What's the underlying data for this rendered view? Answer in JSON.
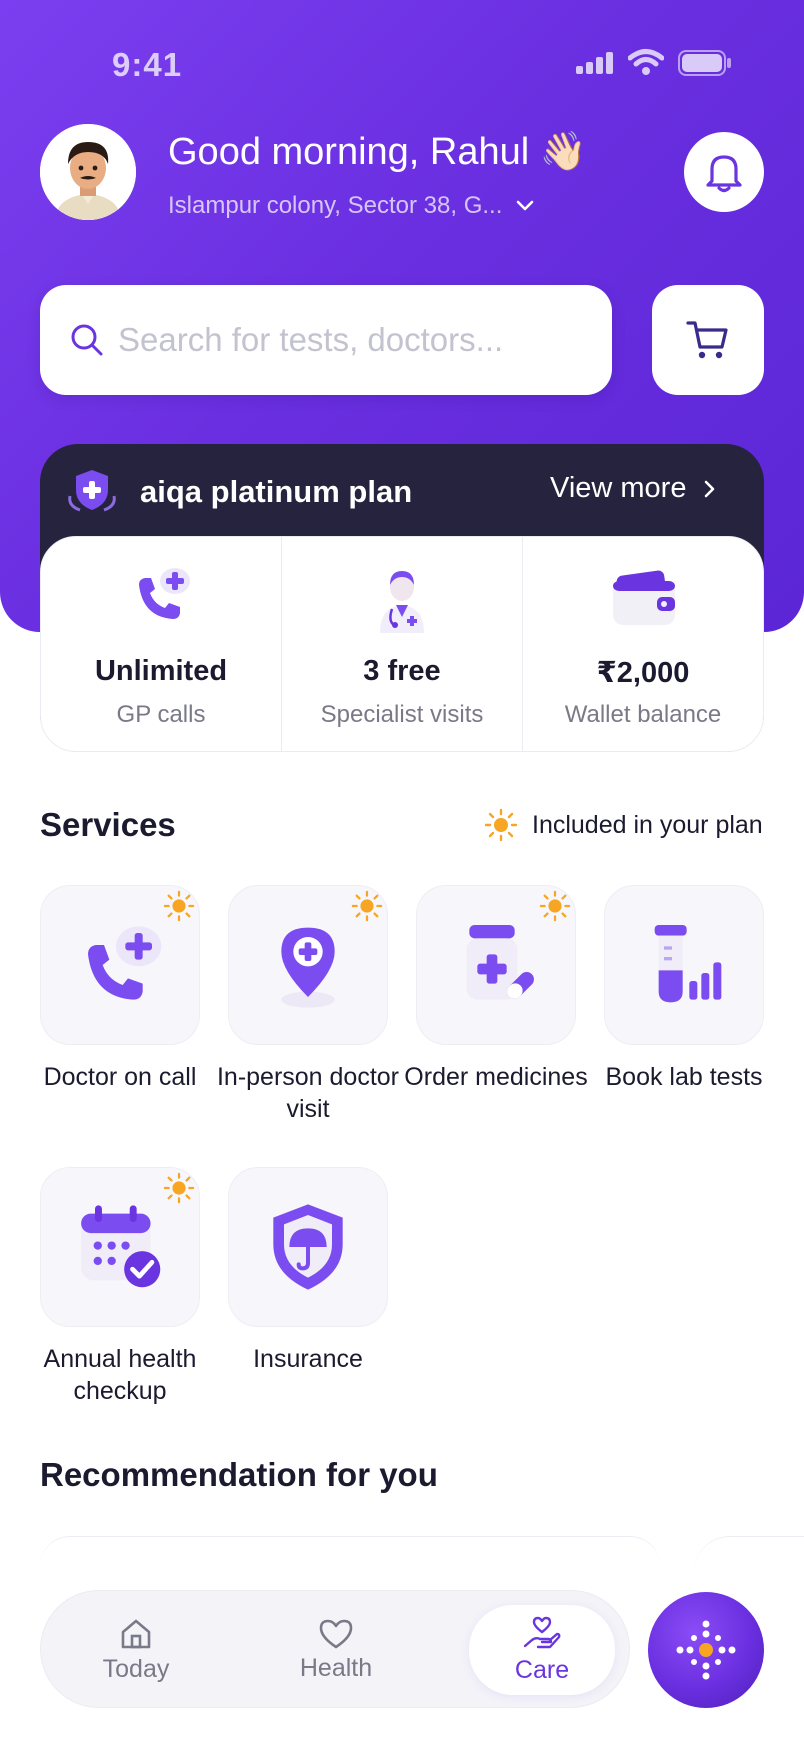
{
  "status_bar": {
    "time": "9:41"
  },
  "header": {
    "greeting": "Good morning, Rahul",
    "wave_emoji": "👋🏻",
    "location": "Islampur colony, Sector 38, G...",
    "avatar_icon": "man-avatar-icon",
    "bell_icon": "bell-icon"
  },
  "search": {
    "placeholder": "Search for tests, doctors...",
    "cart_icon": "cart-icon"
  },
  "plan": {
    "title": "aiqa platinum plan",
    "view_more": "View more",
    "cards": [
      {
        "value": "Unlimited",
        "label": "GP calls",
        "icon": "phone-plus-icon"
      },
      {
        "value": "3 free",
        "label": "Specialist visits",
        "icon": "doctor-icon"
      },
      {
        "value": "₹2,000",
        "label": "Wallet balance",
        "icon": "wallet-icon"
      }
    ]
  },
  "services": {
    "title": "Services",
    "legend": "Included in your plan",
    "items": [
      {
        "label": "Doctor on call",
        "included": true,
        "icon": "phone-plus-icon"
      },
      {
        "label": "In-person doctor visit",
        "included": true,
        "icon": "location-pin-icon"
      },
      {
        "label": "Order medicines",
        "included": true,
        "icon": "medicine-bottle-icon"
      },
      {
        "label": "Book lab tests",
        "included": false,
        "icon": "test-tube-icon"
      },
      {
        "label": "Annual health checkup",
        "included": true,
        "icon": "calendar-check-icon"
      },
      {
        "label": "Insurance",
        "included": false,
        "icon": "shield-umbrella-icon"
      }
    ]
  },
  "recommendation": {
    "title": "Recommendation for you"
  },
  "bottom_nav": {
    "items": [
      {
        "label": "Today",
        "icon": "home-icon"
      },
      {
        "label": "Health",
        "icon": "heart-icon"
      },
      {
        "label": "Care",
        "icon": "care-hand-icon",
        "active": true
      }
    ],
    "ai_button_icon": "sparkle-icon"
  },
  "colors": {
    "primary": "#6a2fe0",
    "plan_dark": "#25233d",
    "sun": "#f6a623",
    "text": "#1b1a2e",
    "muted": "#7a7988"
  }
}
